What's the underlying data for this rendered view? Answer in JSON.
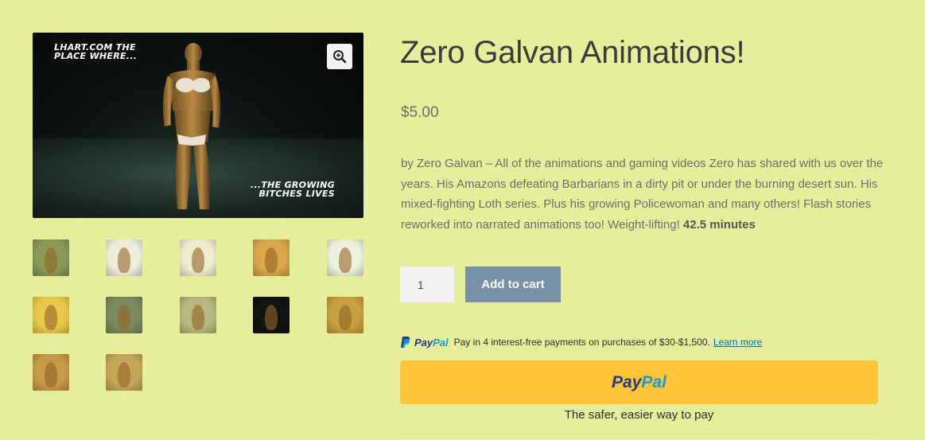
{
  "gallery": {
    "main_caption_top": "LHART.COM THE PLACE WHERE...",
    "main_caption_bottom": "...THE GROWING BITCHES LIVES",
    "zoom_icon": "magnifier-plus-icon",
    "thumbnails": [
      {
        "name": "thumbnail-1",
        "bg": "#8a9a55"
      },
      {
        "name": "thumbnail-2",
        "bg": "#eeeedc"
      },
      {
        "name": "thumbnail-3",
        "bg": "#f0ecd0"
      },
      {
        "name": "thumbnail-4",
        "bg": "#d8a84a"
      },
      {
        "name": "thumbnail-5",
        "bg": "#eef2dc"
      },
      {
        "name": "thumbnail-6",
        "bg": "#e8c84a"
      },
      {
        "name": "thumbnail-7",
        "bg": "#7a8a5e"
      },
      {
        "name": "thumbnail-8",
        "bg": "#b8b880"
      },
      {
        "name": "thumbnail-9",
        "bg": "#101410"
      },
      {
        "name": "thumbnail-10",
        "bg": "#c8a040"
      },
      {
        "name": "thumbnail-11",
        "bg": "#c89a48"
      },
      {
        "name": "thumbnail-12",
        "bg": "#c4a858"
      }
    ]
  },
  "product": {
    "title": "Zero Galvan Animations!",
    "price": "$5.00",
    "description": "by Zero Galvan – All of the animations and gaming videos Zero has shared with us over the years. His Amazons defeating Barbarians in a dirty pit or under the burning desert sun. His mixed-fighting Loth series. Plus his growing Policewoman and many others! Flash stories reworked into narrated animations too! Weight-lifting!",
    "duration": "42.5 minutes"
  },
  "cart": {
    "quantity": "1",
    "add_to_cart_label": "Add to cart"
  },
  "paypal": {
    "logo_dark": "Pay",
    "logo_light": "Pal",
    "paylater_text": "Pay in 4 interest-free payments on purchases of $30-$1,500.",
    "learn_more": "Learn more",
    "button_dark": "Pay",
    "button_light": "Pal",
    "tagline": "The safer, easier way to pay"
  },
  "colors": {
    "page_bg": "#e6ee9c",
    "add_to_cart_bg": "#7891a6",
    "paypal_button_bg": "#ffc439",
    "paypal_dark": "#253b80",
    "paypal_light": "#179bd7"
  }
}
